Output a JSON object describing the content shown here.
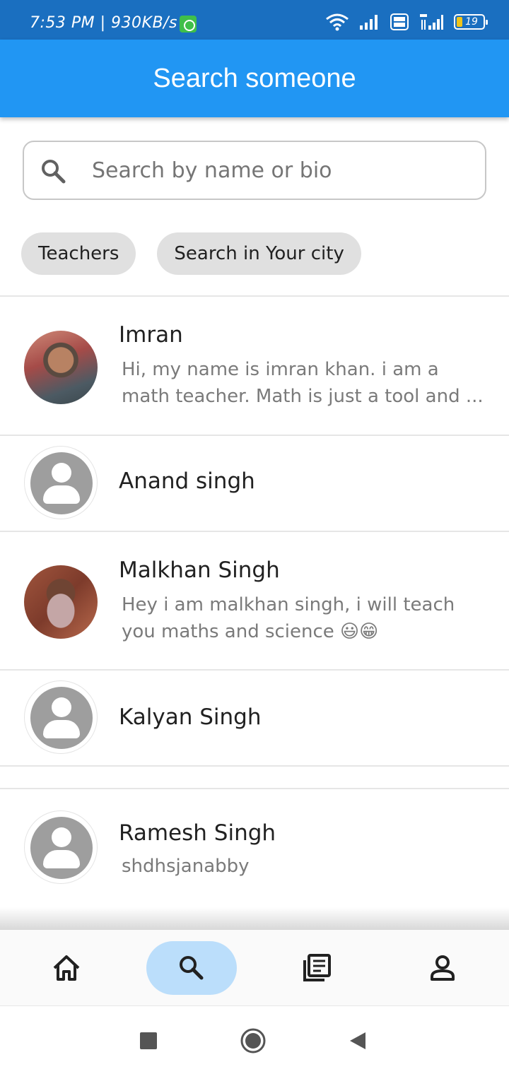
{
  "status_bar": {
    "time": "7:53 PM | 930KB/s",
    "battery": "19"
  },
  "app_bar": {
    "title": "Search someone"
  },
  "search": {
    "placeholder": "Search by name or bio",
    "value": ""
  },
  "chips": [
    {
      "label": "Teachers"
    },
    {
      "label": "Search in Your city"
    }
  ],
  "people": [
    {
      "name": "Imran",
      "bio_line1": "Hi, my name is imran khan. i am a",
      "bio_line2": "math teacher. Math is just a tool and ..."
    },
    {
      "name": "Anand singh"
    },
    {
      "name": "Malkhan Singh",
      "bio_line1": "Hey i am malkhan singh, i will teach",
      "bio_line2": "you maths and science 😃😁"
    },
    {
      "name": "Kalyan Singh"
    },
    {
      "name": "Ramesh Singh",
      "bio_line1": "shdhsjanabby"
    }
  ],
  "bottom_nav": {
    "items": [
      {
        "icon": "home-icon"
      },
      {
        "icon": "search-icon",
        "active": true
      },
      {
        "icon": "news-icon"
      },
      {
        "icon": "person-icon"
      }
    ]
  },
  "colors": {
    "status_bar": "#1a6fc0",
    "app_bar": "#2196f3",
    "active_nav_pill": "#bbdefb",
    "chip_bg": "#e0e0e0"
  }
}
